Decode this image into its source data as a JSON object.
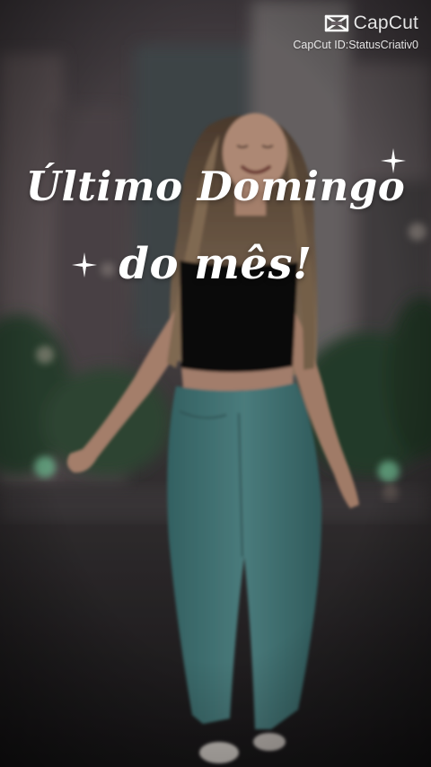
{
  "watermark": {
    "brand": "CapCut",
    "id_text": "CapCut ID:StatusCriativ0",
    "logo_icon": "capcut-logo-icon"
  },
  "headline": {
    "line1": "Último Domingo",
    "line2": "do mês!"
  },
  "decorations": {
    "sparkle_icon": "four-point-star-icon",
    "text_color": "#ffffff"
  },
  "photo": {
    "subject": "woman-walking-street-photo",
    "top_color": "#000000",
    "jeans_color": "#4f8a8b"
  }
}
